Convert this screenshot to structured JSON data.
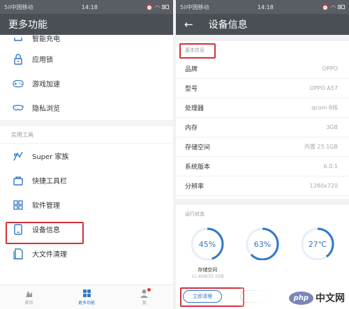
{
  "left": {
    "statusbar": {
      "carrier": "5il中国移动",
      "time": "14:18"
    },
    "title": "更多功能",
    "items_top": [
      {
        "label": "智能充电",
        "icon": "charge-icon"
      },
      {
        "label": "应用锁",
        "icon": "lock-icon"
      },
      {
        "label": "游戏加速",
        "icon": "gamepad-icon"
      },
      {
        "label": "隐私浏览",
        "icon": "mask-icon"
      }
    ],
    "section_label": "实用工具",
    "items_tools": [
      {
        "label": "Super 家族",
        "icon": "super-icon"
      },
      {
        "label": "快捷工具栏",
        "icon": "toolbar-icon"
      },
      {
        "label": "软件管理",
        "icon": "grid-icon"
      },
      {
        "label": "设备信息",
        "icon": "phone-icon"
      },
      {
        "label": "大文件清理",
        "icon": "file-icon"
      }
    ],
    "bottom_nav": [
      {
        "label": "首页",
        "active": false
      },
      {
        "label": "更多功能",
        "active": true
      },
      {
        "label": "我",
        "active": false
      }
    ],
    "accent_color": "#2f78c6",
    "highlight_color": "#d0323a"
  },
  "right": {
    "statusbar": {
      "carrier": "5il中国移动",
      "time": "14:18"
    },
    "title": "设备信息",
    "back_icon": "arrow-left-icon",
    "basic_label": "基本信息",
    "info": [
      {
        "key": "品牌",
        "value": "OPPO"
      },
      {
        "key": "型号",
        "value": "OPPO A57"
      },
      {
        "key": "处理器",
        "value": "qcom 8核"
      },
      {
        "key": "内存",
        "value": "3GB"
      },
      {
        "key": "存储空间",
        "value": "内置 25.1GB"
      },
      {
        "key": "系统版本",
        "value": "6.0.1"
      },
      {
        "key": "分辨率",
        "value": "1280x720"
      }
    ],
    "running_label": "运行状态",
    "gauges": [
      {
        "value_text": "45%",
        "percent": 45,
        "caption": "存储空间",
        "sub": "11.4GB/25.1GB"
      },
      {
        "value_text": "63%",
        "percent": 63,
        "caption": "",
        "sub": ""
      },
      {
        "value_text": "27℃",
        "percent": 40,
        "caption": "",
        "sub": ""
      }
    ],
    "clean_button": "立即清理"
  },
  "watermark": {
    "php": "php",
    "cn": "中文网"
  }
}
